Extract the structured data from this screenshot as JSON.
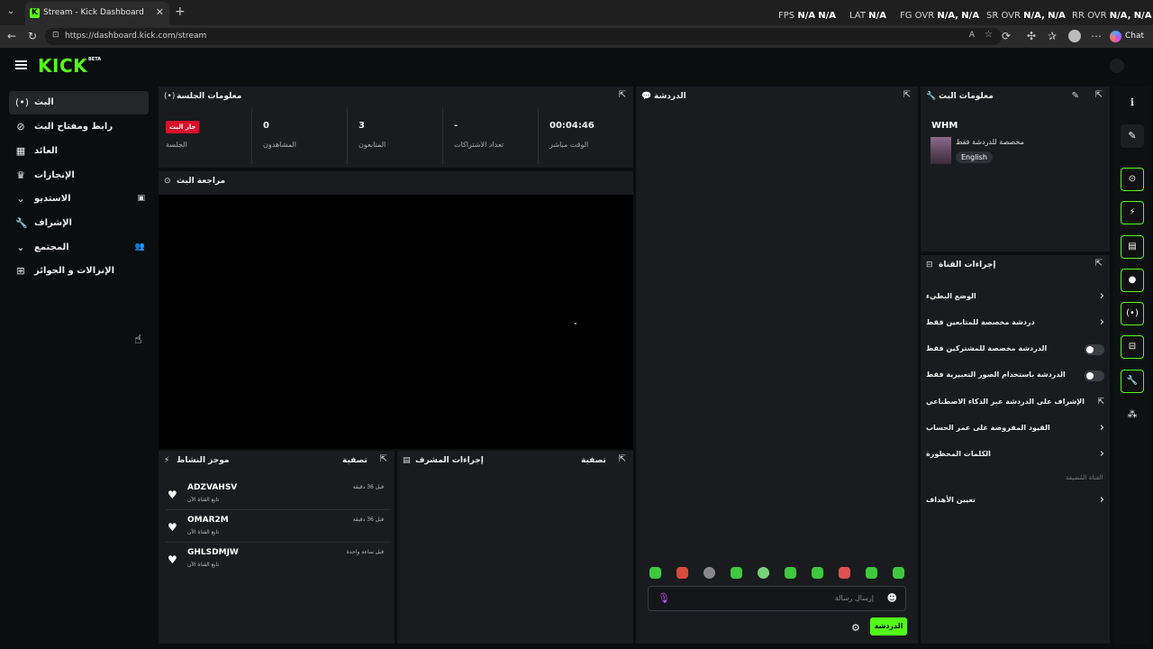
{
  "browser": {
    "tab_title": "Stream - Kick Dashboard",
    "url": "https://dashboard.kick.com/stream",
    "chat_label": "Chat",
    "overlay_stats": [
      {
        "label": "FPS",
        "v1": "N/A",
        "v2": "N/A"
      },
      {
        "label": "LAT",
        "v1": "N/A",
        "v2": ""
      },
      {
        "label": "FG OVR",
        "v1": "N/A,",
        "v2": "N/A"
      },
      {
        "label": "SR OVR",
        "v1": "N/A,",
        "v2": "N/A"
      },
      {
        "label": "RR OVR",
        "v1": "N/A,",
        "v2": "N/A"
      }
    ]
  },
  "header": {
    "logo": "KICK",
    "beta": "BETA"
  },
  "sidebar": {
    "items": [
      {
        "label": "البث",
        "icon": "broadcast-icon"
      },
      {
        "label": "رابط ومفتاح البث",
        "icon": "link-icon"
      },
      {
        "label": "العائد",
        "icon": "revenue-icon"
      },
      {
        "label": "الإنجازات",
        "icon": "trophy-icon"
      },
      {
        "label": "الاستديو",
        "icon": "studio-icon"
      },
      {
        "label": "الإشراف",
        "icon": "wrench-icon"
      },
      {
        "label": "المجتمع",
        "icon": "community-icon"
      },
      {
        "label": "الإنزالات و الجوائز",
        "icon": "drops-icon"
      }
    ]
  },
  "session": {
    "title": "معلومات الجلسة",
    "badge": "جار البث",
    "session_label": "الجلسة",
    "viewers_value": "0",
    "viewers_label": "المشاهدون",
    "followers_value": "3",
    "followers_label": "المتابعون",
    "subs_value": "-",
    "subs_label": "تعداد الاشتراكات",
    "time_value": "00:04:46",
    "time_label": "الوقت مباشر"
  },
  "preview": {
    "title": "مراجعة البث"
  },
  "activity": {
    "title": "موجز النشاط",
    "filter": "تصفية",
    "items": [
      {
        "name": "ADZVAHSV",
        "sub": "تابع القناة الآن",
        "time": "قبل 36 دقيقة"
      },
      {
        "name": "OMAR2M",
        "sub": "تابع القناة الآن",
        "time": "قبل 36 دقيقة"
      },
      {
        "name": "GHLSDMJW",
        "sub": "تابع القناة الآن",
        "time": "قبل ساعة واحدة"
      }
    ]
  },
  "mod_actions": {
    "title": "إجراءات المشرف",
    "filter": "تصفية"
  },
  "chat": {
    "title": "الدردشة",
    "placeholder": "إرسال رسالة",
    "send_label": "الدردشة"
  },
  "stream_info": {
    "title": "معلومات البث",
    "stream_title": "WHM",
    "subtitle": "مخصصة للدردشة فقط",
    "language_tag": "English"
  },
  "channel_actions": {
    "title": "إجراءات القناة",
    "items": [
      {
        "label": "الوضع البطيء",
        "kind": "chevron"
      },
      {
        "label": "دردشة مخصصة للمتابعين فقط",
        "kind": "chevron"
      },
      {
        "label": "الدردشة مخصصة للمشتركين فقط",
        "kind": "toggle"
      },
      {
        "label": "الدردشة باستخدام الصور التعبيرية فقط",
        "kind": "toggle"
      },
      {
        "label": "الإشراف على الدردشة عبر الذكاء الاصطناعي",
        "kind": "external"
      },
      {
        "label": "القيود المفروضة على عمر الحساب",
        "kind": "chevron"
      },
      {
        "label": "الكلمات المحظورة",
        "kind": "chevron"
      }
    ],
    "section_label": "القناة المُضيفة",
    "goals_label": "تعيين الأهداف"
  },
  "colors": {
    "accent": "#53fc18",
    "live": "#d8112b",
    "panel": "#191b1f",
    "bg": "#0b0e0f"
  }
}
